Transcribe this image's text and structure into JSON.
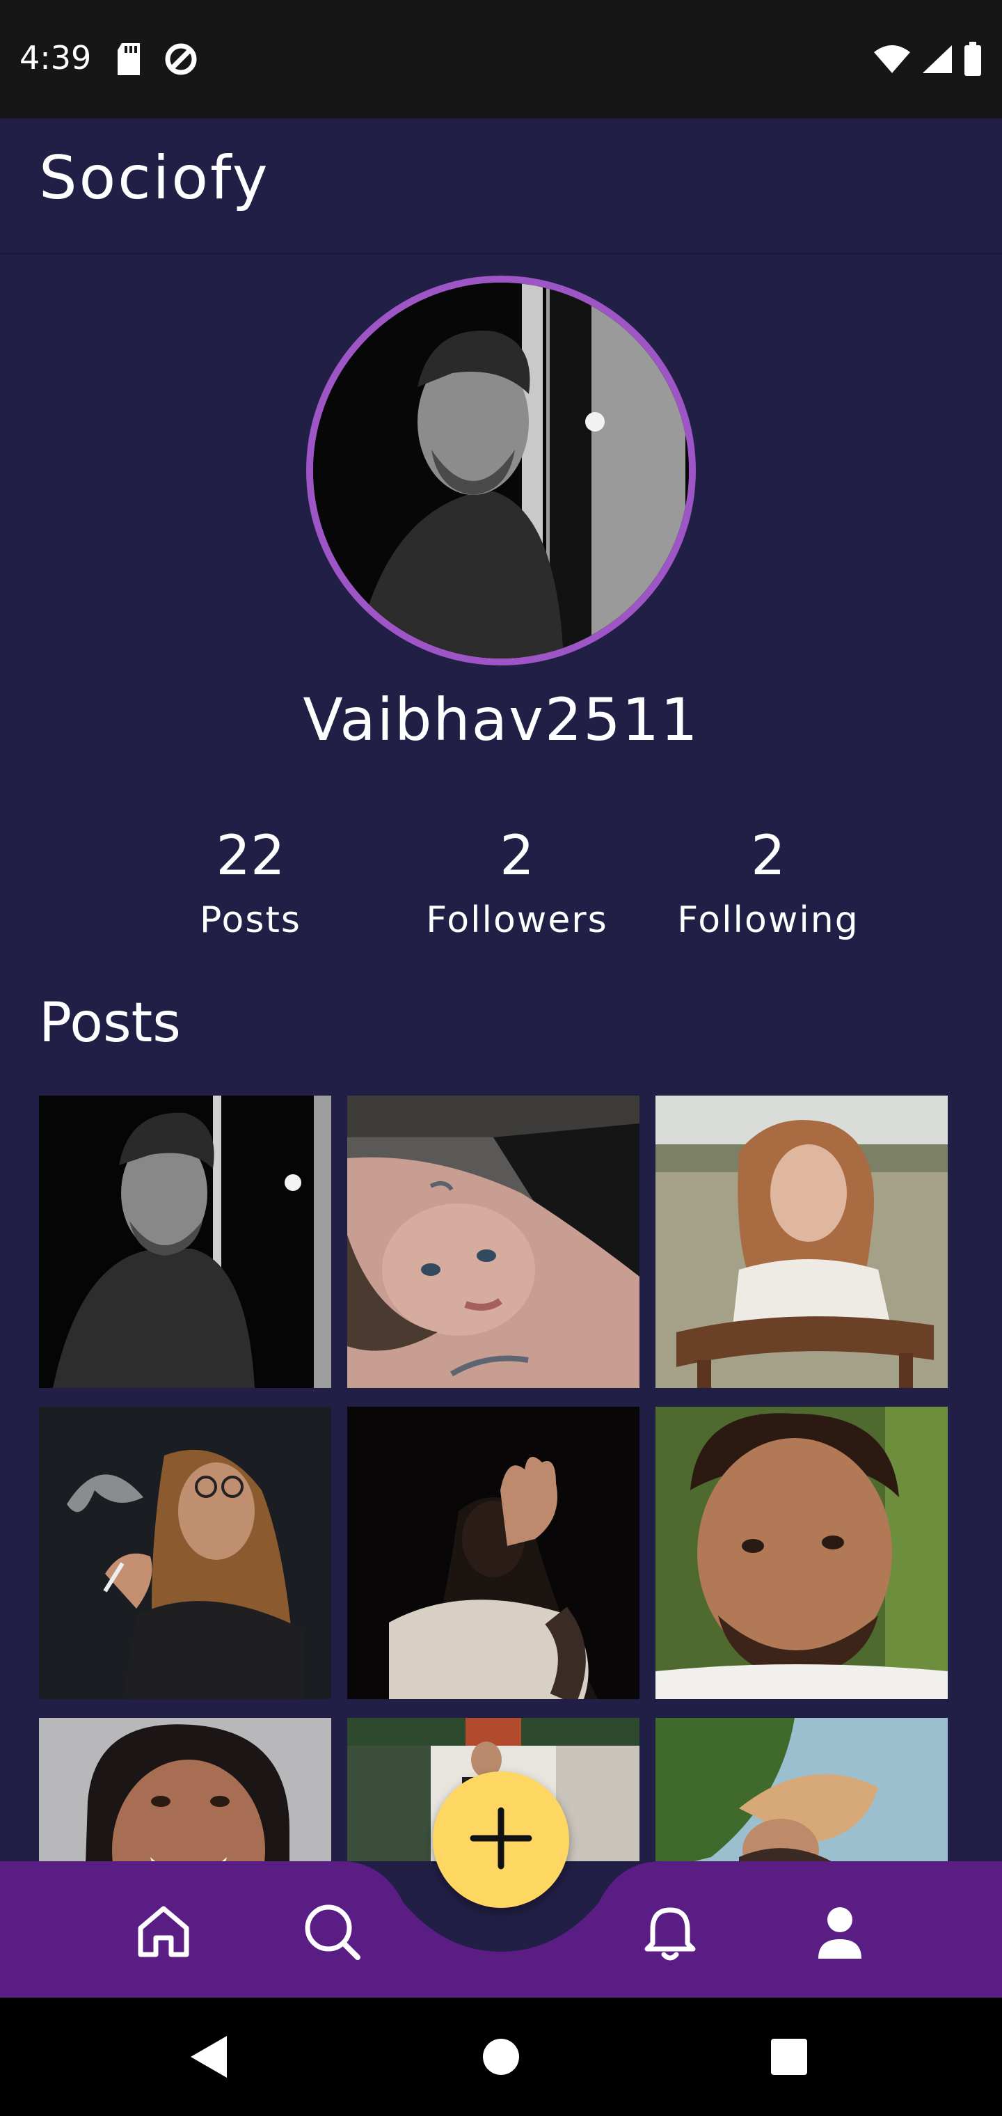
{
  "status_bar": {
    "time": "4:39",
    "icons_left": [
      "sd-card-icon",
      "data-saver-icon"
    ],
    "icons_right": [
      "wifi-icon",
      "cellular-signal-icon",
      "battery-icon"
    ]
  },
  "header": {
    "app_name": "Sociofy"
  },
  "profile": {
    "username": "Vaibhav2511",
    "avatar_ring_color": "#9e55c5",
    "stats": [
      {
        "value": "22",
        "label": "Posts"
      },
      {
        "value": "2",
        "label": "Followers"
      },
      {
        "value": "2",
        "label": "Following"
      }
    ]
  },
  "posts_section": {
    "title": "Posts",
    "items": [
      "post-thumbnail-bw-man",
      "post-thumbnail-woman-lying",
      "post-thumbnail-woman-field",
      "post-thumbnail-woman-smoke",
      "post-thumbnail-hand-dark",
      "post-thumbnail-man-closeup",
      "post-thumbnail-woman-smiling",
      "post-thumbnail-man-building",
      "post-thumbnail-woman-hat"
    ]
  },
  "bottom_nav": {
    "background": "#5a1d84",
    "fab_color": "#fdd762",
    "items": [
      "home-icon",
      "search-icon",
      "add-icon",
      "bell-icon",
      "profile-icon"
    ]
  },
  "system_nav": {
    "items": [
      "back-icon",
      "home-circle-icon",
      "recents-icon"
    ]
  }
}
